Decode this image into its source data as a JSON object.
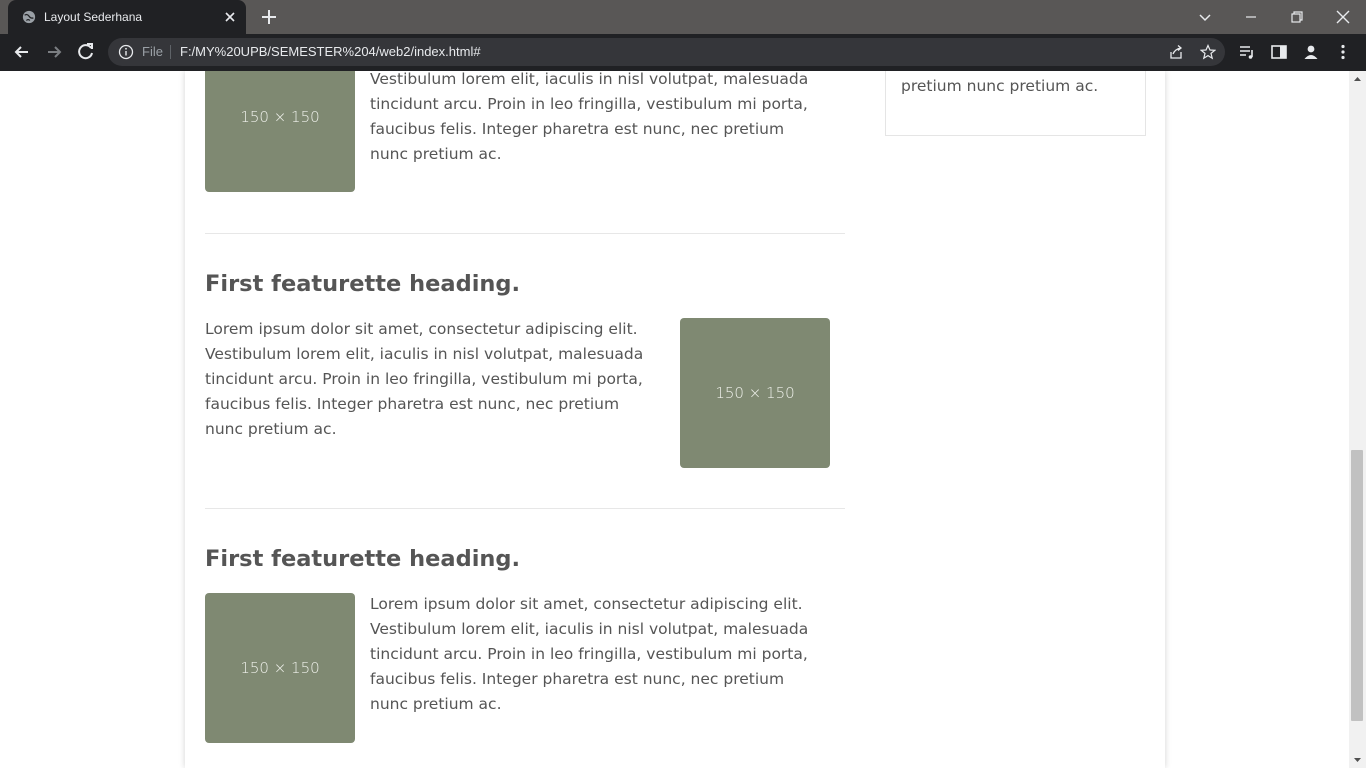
{
  "browser": {
    "tab_title": "Layout Sederhana",
    "omnibox_scheme": "File",
    "url": "F:/MY%20UPB/SEMESTER%204/web2/index.html#"
  },
  "sidebar": {
    "text_fragment": "pharetra est nunc, nec pretium nunc pretium ac."
  },
  "featurettes": [
    {
      "heading": "",
      "image_label": "150 × 150",
      "text": "Vestibulum lorem elit, iaculis in nisl volutpat, malesuada tincidunt arcu. Proin in leo fringilla, vestibulum mi porta, faucibus felis. Integer pharetra est nunc, nec pretium nunc pretium ac."
    },
    {
      "heading": "First featurette heading.",
      "image_label": "150 × 150",
      "text": "Lorem ipsum dolor sit amet, consectetur adipiscing elit. Vestibulum lorem elit, iaculis in nisl volutpat, malesuada tincidunt arcu. Proin in leo fringilla, vestibulum mi porta, faucibus felis. Integer pharetra est nunc, nec pretium nunc pretium ac."
    },
    {
      "heading": "First featurette heading.",
      "image_label": "150 × 150",
      "text": "Lorem ipsum dolor sit amet, consectetur adipiscing elit. Vestibulum lorem elit, iaculis in nisl volutpat, malesuada tincidunt arcu. Proin in leo fringilla, vestibulum mi porta, faucibus felis. Integer pharetra est nunc, nec pretium nunc pretium ac."
    }
  ],
  "colors": {
    "placeholder_bg": "#7f8972",
    "text": "#555555",
    "chrome_bg": "#202124",
    "tabstrip_bg": "#595756"
  }
}
